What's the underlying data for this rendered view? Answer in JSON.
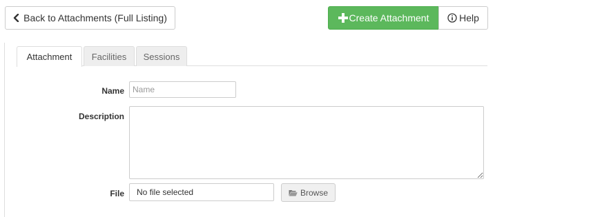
{
  "toolbar": {
    "back_label": "Back to Attachments (Full Listing)",
    "create_label": "Create Attachment",
    "help_label": "Help",
    "icons": {
      "back": "chevron-left-icon",
      "create": "plus-icon",
      "help": "info-circle-icon"
    }
  },
  "colors": {
    "primary_green": "#5cb85c"
  },
  "tabs": [
    {
      "label": "Attachment",
      "active": true
    },
    {
      "label": "Facilities",
      "active": false
    },
    {
      "label": "Sessions",
      "active": false
    }
  ],
  "form": {
    "name": {
      "label": "Name",
      "placeholder": "Name",
      "value": ""
    },
    "description": {
      "label": "Description",
      "value": ""
    },
    "file": {
      "label": "File",
      "value": "No file selected",
      "browse_label": "Browse",
      "browse_icon": "folder-open-icon"
    }
  }
}
